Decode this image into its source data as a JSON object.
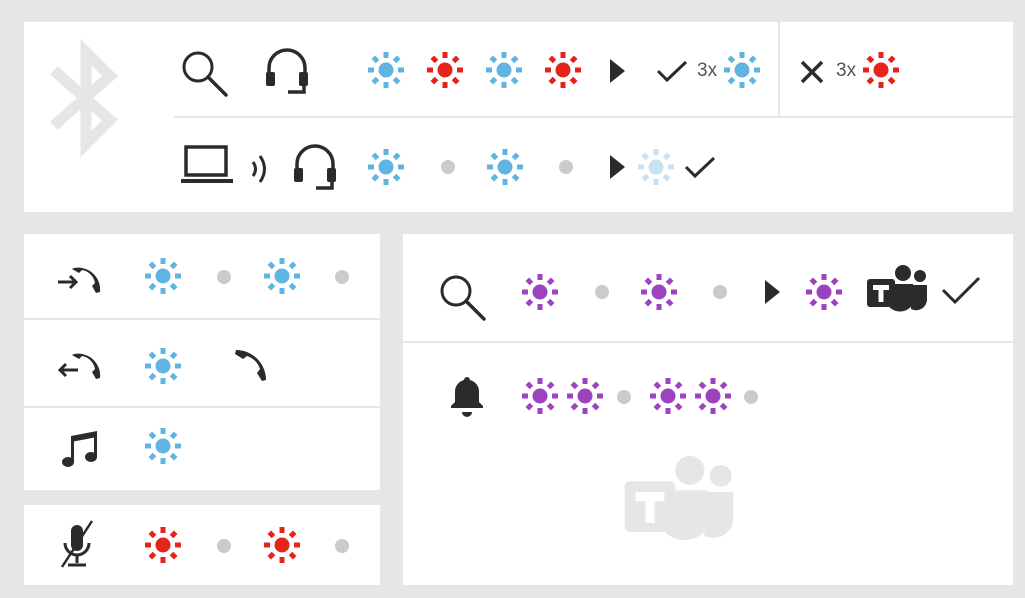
{
  "colors": {
    "blue": "#5fb4e2",
    "blue_faded": "#c6e2f3",
    "red": "#e4231b",
    "purple": "#9c44c0",
    "grey_dot": "#cbcbcb",
    "icon": "#2b2b2b",
    "watermark": "#e6e6e6"
  },
  "pairing": {
    "success_multiplier": "3x",
    "failure_multiplier": "3x"
  },
  "icons": {
    "watermark_bluetooth": "bluetooth-icon",
    "search": "search-icon",
    "headset": "headset-icon",
    "laptop": "laptop-icon",
    "signal": "signal-waves-icon",
    "check": "check-icon",
    "cross": "cross-icon",
    "play": "play-triangle-icon",
    "incoming_call": "incoming-call-icon",
    "outgoing_call": "outgoing-call-icon",
    "handset": "handset-icon",
    "music": "music-note-icon",
    "mic_muted": "mic-muted-icon",
    "bell": "bell-icon",
    "teams": "teams-icon",
    "teams_watermark": "teams-watermark-icon"
  }
}
